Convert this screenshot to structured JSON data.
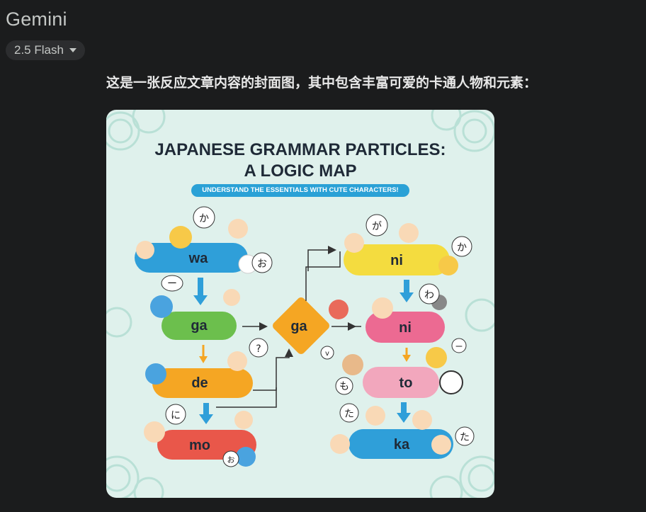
{
  "app": {
    "title": "Gemini",
    "model": "2.5 Flash"
  },
  "message": {
    "text": "这是一张反应文章内容的封面图，其中包含丰富可爱的卡通人物和元素："
  },
  "poster": {
    "title_line1": "JAPANESE GRAMMAR PARTICLES:",
    "title_line2": "A LOGIC MAP",
    "subtitle": "UNDERSTAND THE ESSENTIALS WITH CUTE CHARACTERS!",
    "left_pills": [
      "wa",
      "ga",
      "de",
      "mo"
    ],
    "center": "ga",
    "right_pills": [
      "ni",
      "ni",
      "to",
      "ka"
    ],
    "bubbles": [
      "か",
      "お",
      "ー",
      "?",
      "に",
      "お",
      "が",
      "か",
      "わ",
      "v",
      "も",
      "ー",
      "た",
      "た"
    ],
    "colors": {
      "background": "#dff1ec",
      "blue": "#2f9fd9",
      "green": "#6cbf4d",
      "orange": "#f5a623",
      "red": "#e9574a",
      "yellow": "#f4dc3f",
      "pink": "#ec6a92",
      "lightpink": "#f2a7bd",
      "diamond": "#f5a623"
    }
  }
}
